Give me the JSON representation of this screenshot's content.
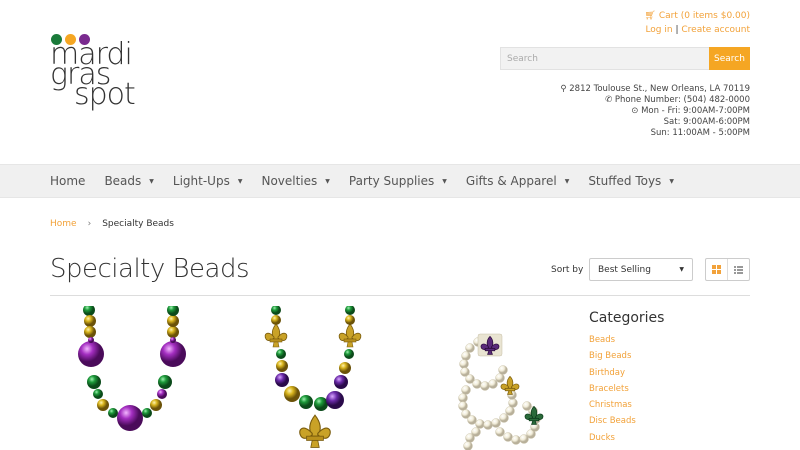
{
  "brand": {
    "words": [
      "mardi",
      "gras",
      "spot"
    ],
    "dot_colors": [
      "#1a7a3a",
      "#f5a623",
      "#7a2a8f"
    ]
  },
  "header": {
    "cart": "Cart (0 items $0.00)",
    "login": "Log in",
    "separator": "|",
    "create_account": "Create account",
    "search_placeholder": "Search",
    "search_button": "Search",
    "address": "2812 Toulouse St., New Orleans, LA 70119",
    "phone": "Phone Number: (504) 482-0000",
    "hours_weekday": "Mon - Fri: 9:00AM-7:00PM",
    "hours_sat": "Sat: 9:00AM-6:00PM",
    "hours_sun": "Sun: 11:00AM - 5:00PM"
  },
  "nav": [
    {
      "label": "Home",
      "dropdown": false
    },
    {
      "label": "Beads",
      "dropdown": true
    },
    {
      "label": "Light-Ups",
      "dropdown": true
    },
    {
      "label": "Novelties",
      "dropdown": true
    },
    {
      "label": "Party Supplies",
      "dropdown": true
    },
    {
      "label": "Gifts & Apparel",
      "dropdown": true
    },
    {
      "label": "Stuffed Toys",
      "dropdown": true
    }
  ],
  "breadcrumb": {
    "home": "Home",
    "arrow": "›",
    "current": "Specialty Beads"
  },
  "page": {
    "title": "Specialty Beads",
    "sort_label": "Sort by",
    "sort_value": "Best Selling"
  },
  "sidebar": {
    "heading": "Categories",
    "items": [
      "Beads",
      "Big Beads",
      "Birthday",
      "Bracelets",
      "Christmas",
      "Disc Beads",
      "Ducks"
    ]
  },
  "colors": {
    "accent": "#f5a623",
    "purple": "#8a2a9e",
    "green": "#1f8a3a",
    "gold": "#d9b21c"
  }
}
